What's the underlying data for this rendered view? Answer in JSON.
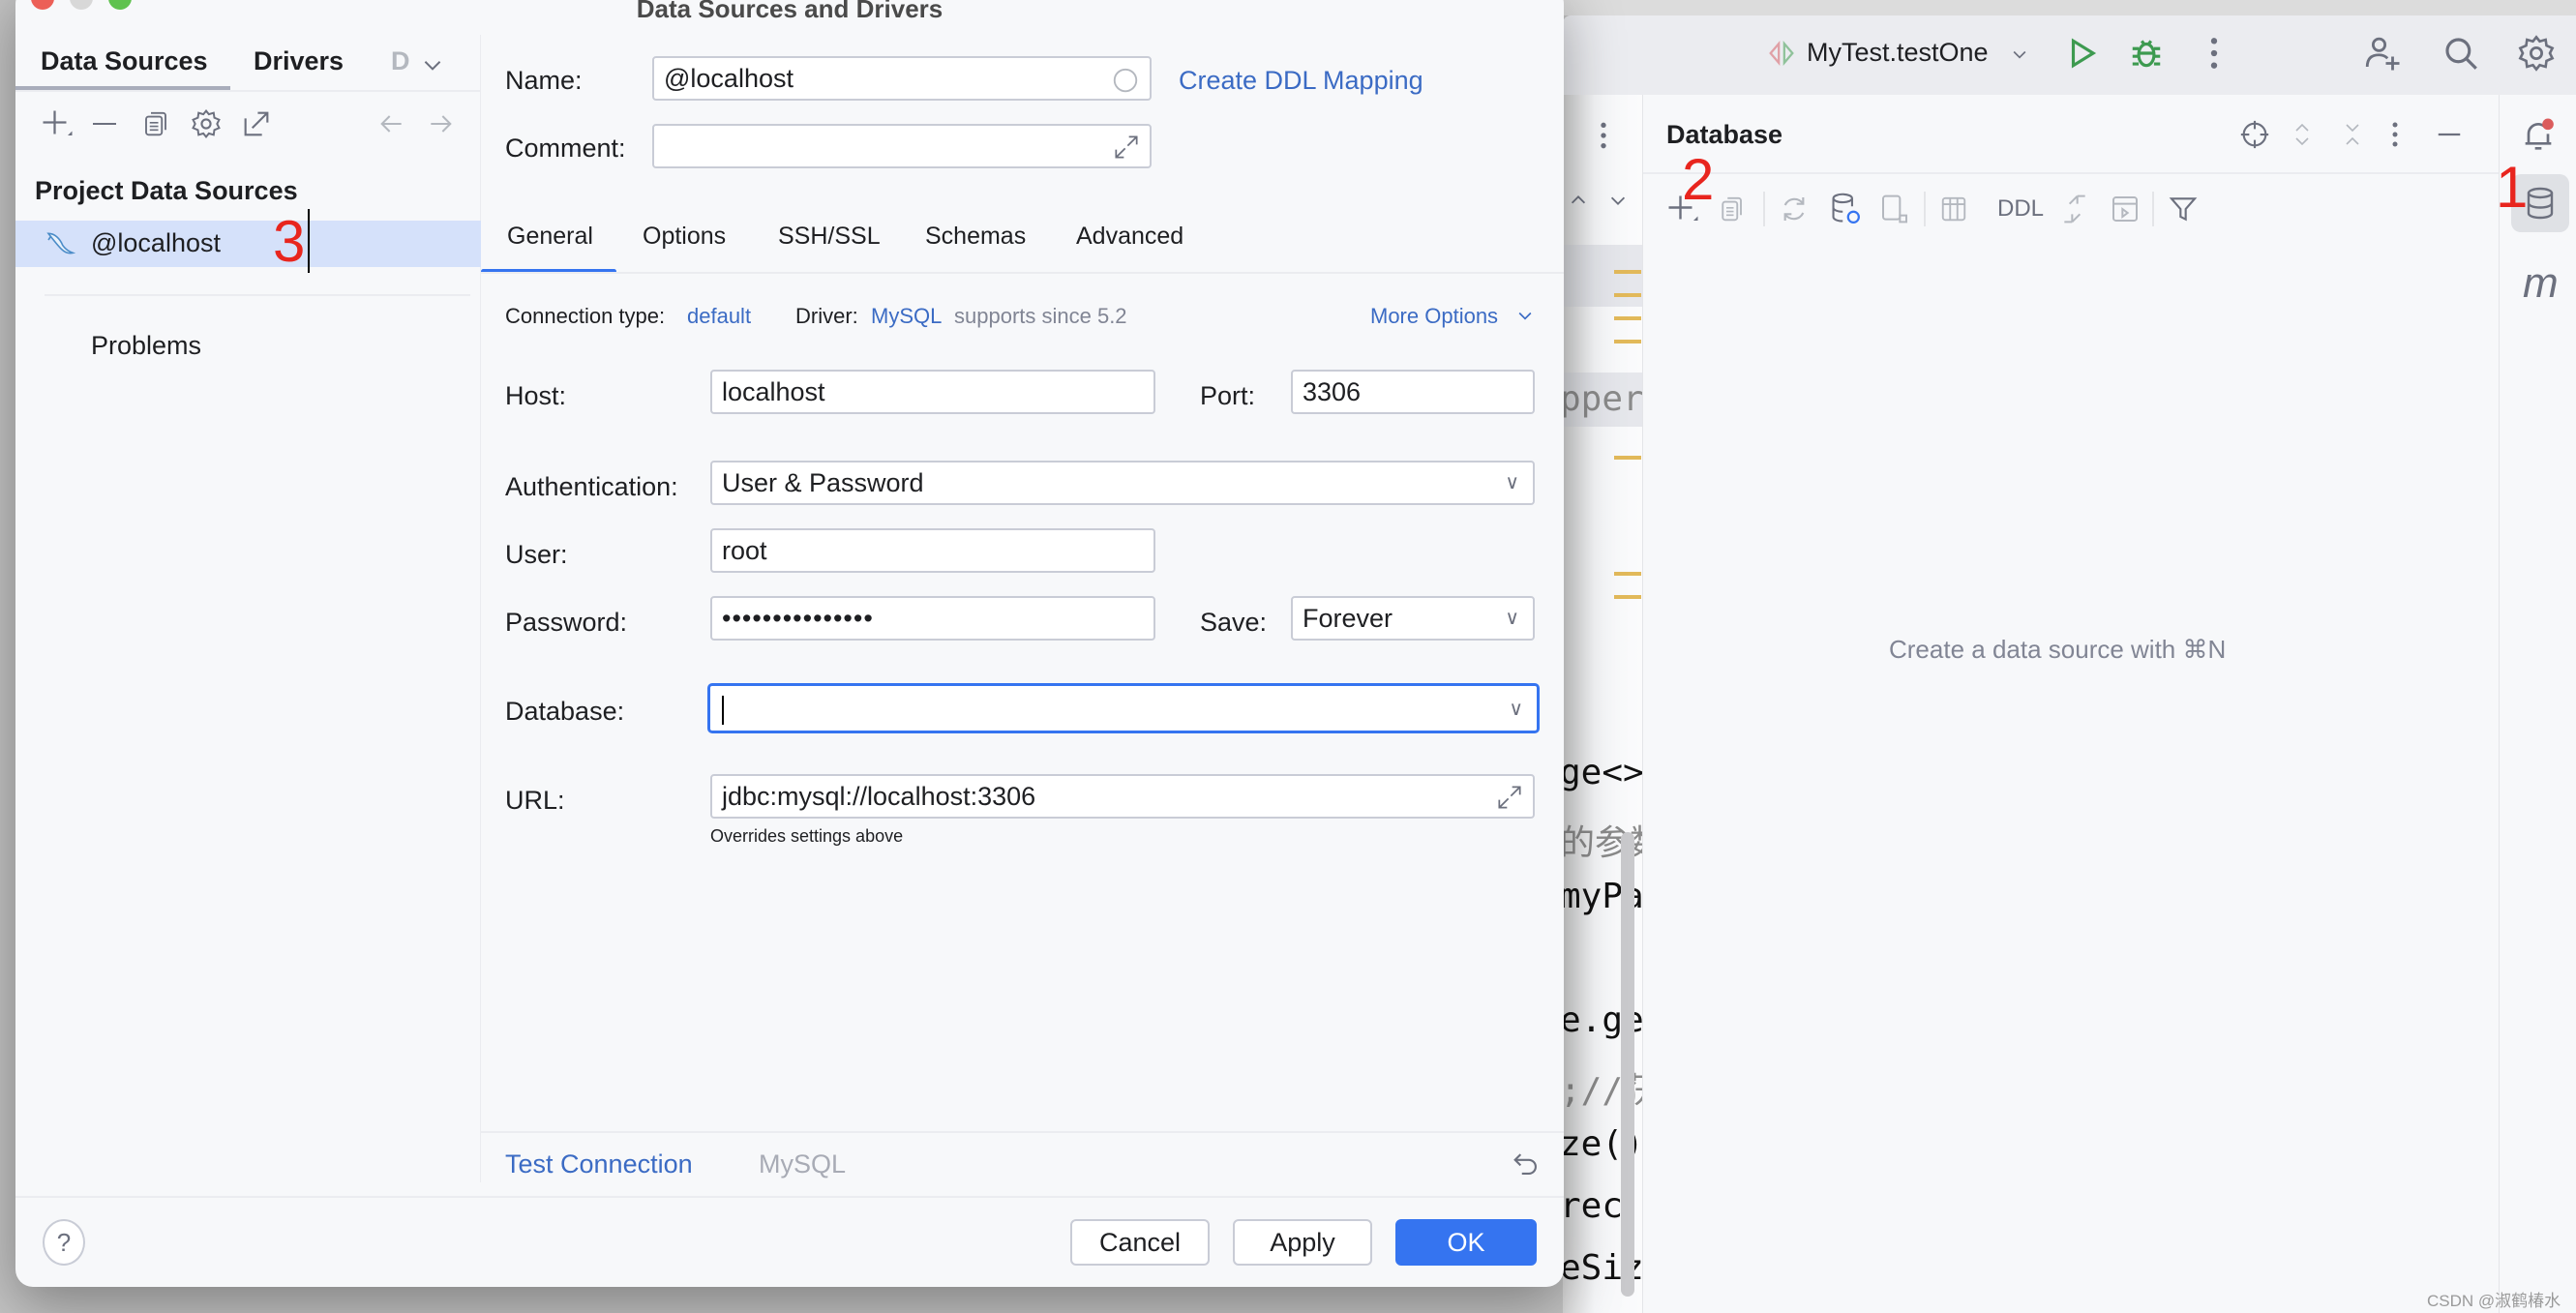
{
  "dialog": {
    "title": "Data Sources and Drivers",
    "left_tabs": [
      "Data Sources",
      "Drivers",
      "D"
    ],
    "section_header": "Project Data Sources",
    "data_sources": [
      {
        "name": "@localhost",
        "icon": "mysql-dolphin-icon",
        "selected": true
      }
    ],
    "problems_label": "Problems",
    "annotation": "3",
    "form": {
      "name_label": "Name:",
      "name_value": "@localhost",
      "create_ddl_link": "Create DDL Mapping",
      "comment_label": "Comment:",
      "comment_value": "",
      "tabs": [
        "General",
        "Options",
        "SSH/SSL",
        "Schemas",
        "Advanced"
      ],
      "active_tab": "General",
      "connection_type_label": "Connection type:",
      "connection_type_value": "default",
      "driver_label": "Driver:",
      "driver_value": "MySQL",
      "driver_note": "supports since 5.2",
      "more_options": "More Options",
      "host_label": "Host:",
      "host_value": "localhost",
      "port_label": "Port:",
      "port_value": "3306",
      "auth_label": "Authentication:",
      "auth_value": "User & Password",
      "user_label": "User:",
      "user_value": "root",
      "password_label": "Password:",
      "password_value": "•••••••••••••••",
      "save_label": "Save:",
      "save_value": "Forever",
      "database_label": "Database:",
      "database_value": "",
      "url_label": "URL:",
      "url_value": "jdbc:mysql://localhost:3306",
      "url_hint": "Overrides settings above"
    },
    "footer": {
      "test_connection": "Test Connection",
      "driver_name": "MySQL"
    },
    "buttons": {
      "help": "?",
      "cancel": "Cancel",
      "apply": "Apply",
      "ok": "OK"
    }
  },
  "ide": {
    "run_config": "MyTest.testOne",
    "database_panel": {
      "title": "Database",
      "toolbar_ddl": "DDL",
      "empty_text": "Create a data source with ⌘N",
      "annotation": "2"
    },
    "sidebar_annotation": "1",
    "sidebar_m": "m",
    "code_fragments": [
      "pper:",
      "ge<>",
      "的参数",
      "myPa",
      "e.ge",
      ";//获",
      "ze()",
      " rec",
      "eSiz"
    ]
  },
  "watermark": "CSDN @淑鹤椿水",
  "colors": {
    "accent": "#3574f0",
    "link": "#3b6bc4",
    "selection": "#d5e1fa",
    "annotation": "#e8251e",
    "warning_mark": "#e2b95a"
  }
}
